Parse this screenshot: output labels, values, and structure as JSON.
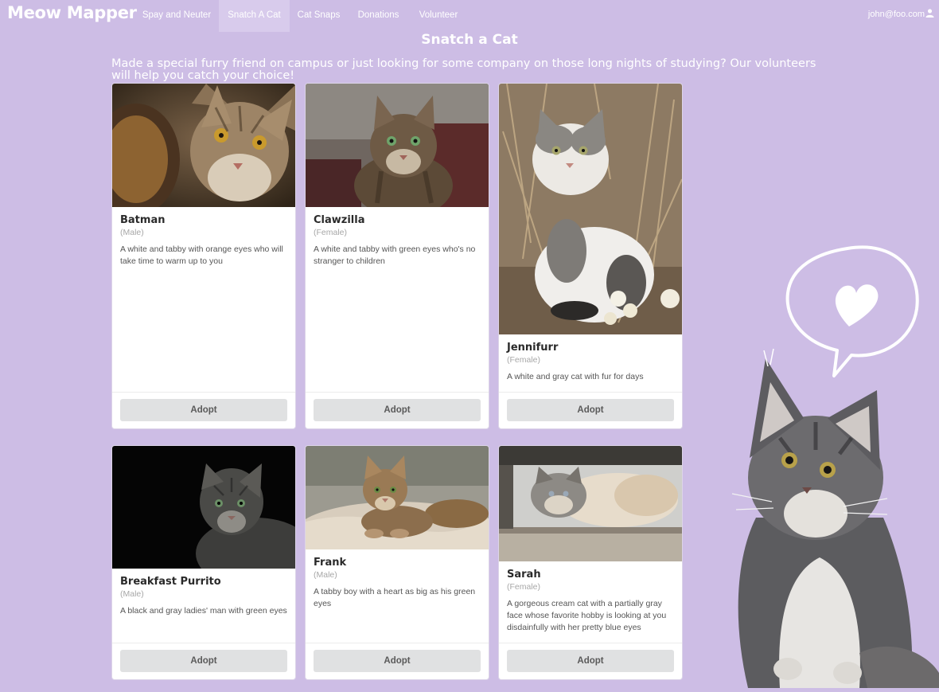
{
  "nav": {
    "brand": "Meow Mapper",
    "items": [
      {
        "label": "Spay and Neuter"
      },
      {
        "label": "Snatch A Cat"
      },
      {
        "label": "Cat Snaps"
      },
      {
        "label": "Donations"
      },
      {
        "label": "Volunteer"
      }
    ],
    "active_item": "Snatch A Cat",
    "user_email": "john@foo.com",
    "user_icon": "user-icon"
  },
  "page": {
    "title": "Snatch a Cat",
    "intro": "Made a special furry friend on campus or just looking for some company on those long nights of studying? Our volunteers will help you catch your choice!"
  },
  "cats": [
    {
      "name": "Batman",
      "gender": "(Male)",
      "description": "A white and tabby with orange eyes who will take time to warm up to you",
      "button": "Adopt"
    },
    {
      "name": "Clawzilla",
      "gender": "(Female)",
      "description": "A white and tabby with green eyes who's no stranger to children",
      "button": "Adopt"
    },
    {
      "name": "Jennifurr",
      "gender": "(Female)",
      "description": "A white and gray cat with fur for days",
      "button": "Adopt"
    },
    {
      "name": "Breakfast Purrito",
      "gender": "(Male)",
      "description": "A black and gray ladies' man with green eyes",
      "button": "Adopt"
    },
    {
      "name": "Frank",
      "gender": "(Male)",
      "description": "A tabby boy with a heart as big as his green eyes",
      "button": "Adopt"
    },
    {
      "name": "Sarah",
      "gender": "(Female)",
      "description": "A gorgeous cream cat with a partially gray face whose favorite hobby is looking at you disdainfully with her pretty blue eyes",
      "button": "Adopt"
    }
  ],
  "colors": {
    "background": "#cdbde5",
    "active_nav": "#d8cbec",
    "button": "#e0e1e2"
  }
}
